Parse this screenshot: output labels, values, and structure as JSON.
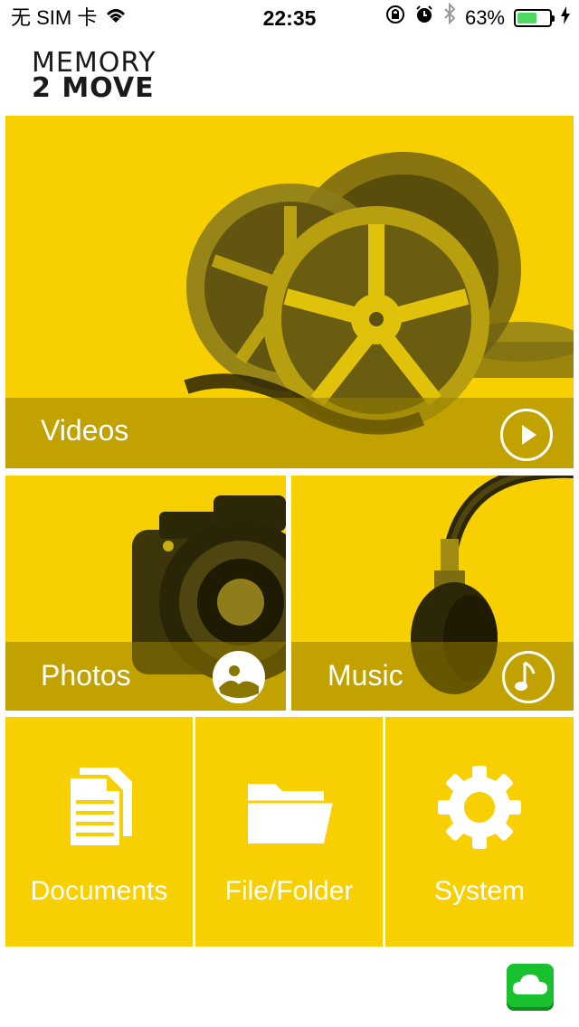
{
  "status_bar": {
    "carrier": "无 SIM 卡",
    "time": "22:35",
    "battery_percent": "63%",
    "battery_level": 0.63,
    "battery_color": "#4cd964"
  },
  "logo": {
    "line1": "MEMORY",
    "line2": "2 MOVE"
  },
  "tiles": {
    "videos": {
      "label": "Videos",
      "icon": "play-icon"
    },
    "photos": {
      "label": "Photos",
      "icon": "photo-icon"
    },
    "music": {
      "label": "Music",
      "icon": "music-note-icon"
    },
    "documents": {
      "label": "Documents",
      "icon": "documents-icon"
    },
    "folder": {
      "label": "File/Folder",
      "icon": "folder-icon"
    },
    "system": {
      "label": "System",
      "icon": "gear-icon"
    }
  },
  "cloud_button": {
    "icon": "cloud-icon"
  },
  "colors": {
    "tile_yellow": "#f8cf00",
    "cloud_green": "#18c12d"
  }
}
